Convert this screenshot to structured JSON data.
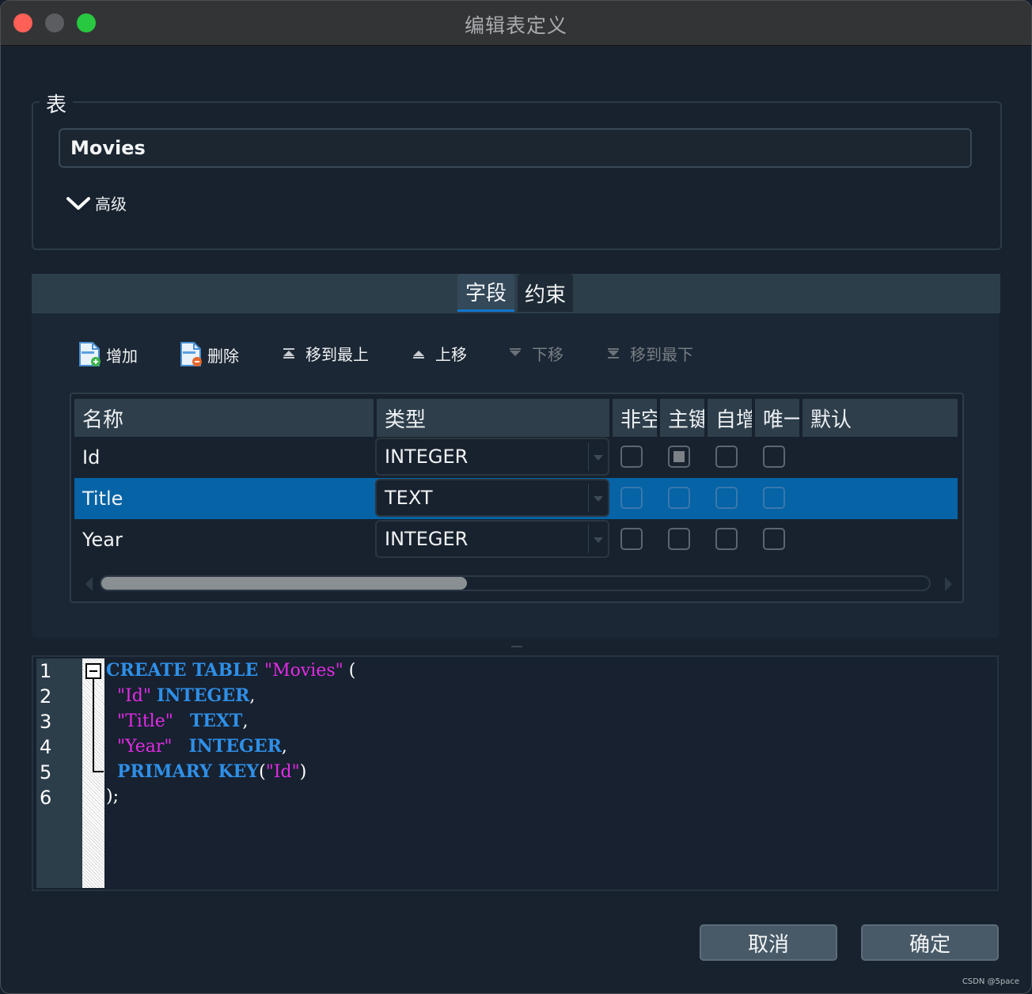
{
  "window": {
    "title": "编辑表定义"
  },
  "table_group": {
    "label": "表",
    "name_value": "Movies",
    "advanced_label": "高级"
  },
  "tabs": [
    {
      "label": "字段",
      "active": true
    },
    {
      "label": "约束",
      "active": false
    }
  ],
  "toolbar": {
    "add_label": "增加",
    "delete_label": "删除",
    "move_top_label": "移到最上",
    "move_up_label": "上移",
    "move_down_label": "下移",
    "move_bottom_label": "移到最下"
  },
  "fields_table": {
    "headers": [
      "名称",
      "类型",
      "非空",
      "主键",
      "自增",
      "唯一",
      "默认"
    ],
    "rows": [
      {
        "name": "Id",
        "type": "INTEGER",
        "not_null": false,
        "primary_key": true,
        "autoincrement": false,
        "unique": false,
        "default": ""
      },
      {
        "name": "Title",
        "type": "TEXT",
        "not_null": false,
        "primary_key": false,
        "autoincrement": false,
        "unique": false,
        "default": "",
        "selected": true
      },
      {
        "name": "Year",
        "type": "INTEGER",
        "not_null": false,
        "primary_key": false,
        "autoincrement": false,
        "unique": false,
        "default": ""
      }
    ]
  },
  "sql_editor": {
    "line_numbers": [
      "1",
      "2",
      "3",
      "4",
      "5",
      "6"
    ],
    "lines": [
      [
        {
          "t": "CREATE TABLE ",
          "c": "kw"
        },
        {
          "t": "\"Movies\"",
          "c": "str"
        },
        {
          "t": " (",
          "c": "pun"
        }
      ],
      [
        {
          "t": "  ",
          "c": "pun"
        },
        {
          "t": "\"Id\"",
          "c": "str"
        },
        {
          "t": " ",
          "c": "pun"
        },
        {
          "t": "INTEGER",
          "c": "kw"
        },
        {
          "t": ",",
          "c": "pun"
        }
      ],
      [
        {
          "t": "  ",
          "c": "pun"
        },
        {
          "t": "\"Title\"",
          "c": "str"
        },
        {
          "t": "   ",
          "c": "pun"
        },
        {
          "t": "TEXT",
          "c": "kw"
        },
        {
          "t": ",",
          "c": "pun"
        }
      ],
      [
        {
          "t": "  ",
          "c": "pun"
        },
        {
          "t": "\"Year\"",
          "c": "str"
        },
        {
          "t": "   ",
          "c": "pun"
        },
        {
          "t": "INTEGER",
          "c": "kw"
        },
        {
          "t": ",",
          "c": "pun"
        }
      ],
      [
        {
          "t": "  ",
          "c": "pun"
        },
        {
          "t": "PRIMARY KEY",
          "c": "kw"
        },
        {
          "t": "(",
          "c": "pun"
        },
        {
          "t": "\"Id\"",
          "c": "str"
        },
        {
          "t": ")",
          "c": "pun"
        }
      ],
      [
        {
          "t": ");",
          "c": "pun"
        }
      ]
    ]
  },
  "buttons": {
    "cancel_label": "取消",
    "ok_label": "确定"
  },
  "watermark": "CSDN @5pace",
  "colors": {
    "selection": "#0563a6",
    "keyword": "#2f8fe6",
    "string": "#e22ce5",
    "close": "#fe5f57",
    "maximize": "#28c840"
  }
}
